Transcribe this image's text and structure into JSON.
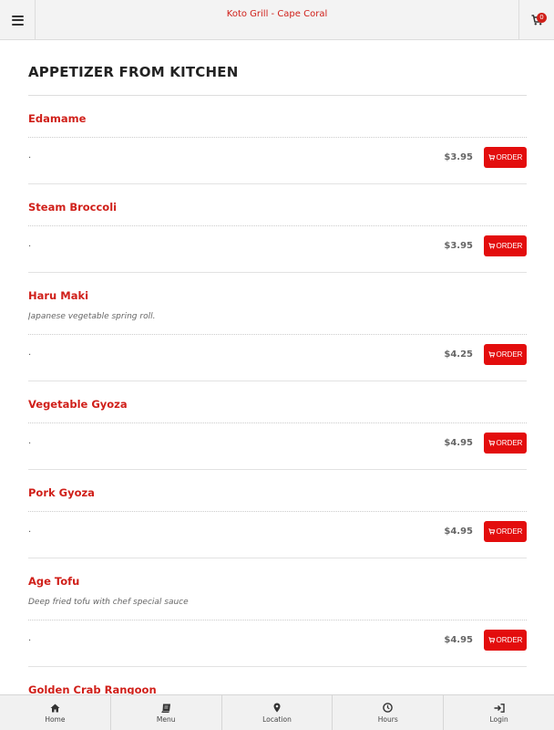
{
  "header": {
    "title": "Koto Grill - Cape Coral",
    "cart_count": "0",
    "icons": {
      "menu": "hamburger-menu-icon",
      "cart": "shopping-cart-icon"
    }
  },
  "section": {
    "title": "APPETIZER FROM KITCHEN"
  },
  "items": [
    {
      "name": "Edamame",
      "description": "",
      "option_text": ".",
      "price": "$3.95",
      "order_label": "ORDER"
    },
    {
      "name": "Steam Broccoli",
      "description": "",
      "option_text": ".",
      "price": "$3.95",
      "order_label": "ORDER"
    },
    {
      "name": "Haru Maki",
      "description": "Japanese vegetable spring roll.",
      "option_text": ".",
      "price": "$4.25",
      "order_label": "ORDER"
    },
    {
      "name": "Vegetable Gyoza",
      "description": "",
      "option_text": ".",
      "price": "$4.95",
      "order_label": "ORDER"
    },
    {
      "name": "Pork Gyoza",
      "description": "",
      "option_text": ".",
      "price": "$4.95",
      "order_label": "ORDER"
    },
    {
      "name": "Age Tofu",
      "description": "Deep fried tofu with chef special sauce",
      "option_text": ".",
      "price": "$4.95",
      "order_label": "ORDER"
    },
    {
      "name": "Golden Crab Rangoon",
      "description": "",
      "option_text": "",
      "price": "",
      "order_label": ""
    }
  ],
  "colors": {
    "accent": "#e30d0d",
    "title_red": "#d0201a"
  },
  "bottom_nav": [
    {
      "label": "Home",
      "icon": "home-icon"
    },
    {
      "label": "Menu",
      "icon": "book-icon"
    },
    {
      "label": "Location",
      "icon": "map-pin-icon"
    },
    {
      "label": "Hours",
      "icon": "clock-icon"
    },
    {
      "label": "Login",
      "icon": "login-icon"
    }
  ]
}
